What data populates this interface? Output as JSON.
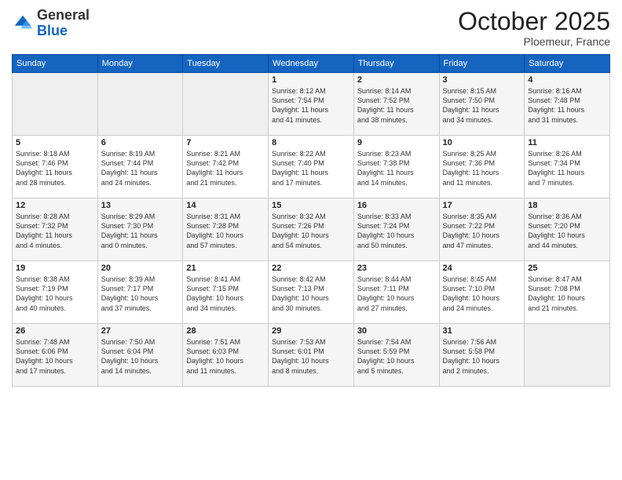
{
  "logo": {
    "general": "General",
    "blue": "Blue"
  },
  "header": {
    "month": "October 2025",
    "location": "Ploemeur, France"
  },
  "days_of_week": [
    "Sunday",
    "Monday",
    "Tuesday",
    "Wednesday",
    "Thursday",
    "Friday",
    "Saturday"
  ],
  "weeks": [
    [
      {
        "day": "",
        "info": ""
      },
      {
        "day": "",
        "info": ""
      },
      {
        "day": "",
        "info": ""
      },
      {
        "day": "1",
        "info": "Sunrise: 8:12 AM\nSunset: 7:54 PM\nDaylight: 11 hours\nand 41 minutes."
      },
      {
        "day": "2",
        "info": "Sunrise: 8:14 AM\nSunset: 7:52 PM\nDaylight: 11 hours\nand 38 minutes."
      },
      {
        "day": "3",
        "info": "Sunrise: 8:15 AM\nSunset: 7:50 PM\nDaylight: 11 hours\nand 34 minutes."
      },
      {
        "day": "4",
        "info": "Sunrise: 8:16 AM\nSunset: 7:48 PM\nDaylight: 11 hours\nand 31 minutes."
      }
    ],
    [
      {
        "day": "5",
        "info": "Sunrise: 8:18 AM\nSunset: 7:46 PM\nDaylight: 11 hours\nand 28 minutes."
      },
      {
        "day": "6",
        "info": "Sunrise: 8:19 AM\nSunset: 7:44 PM\nDaylight: 11 hours\nand 24 minutes."
      },
      {
        "day": "7",
        "info": "Sunrise: 8:21 AM\nSunset: 7:42 PM\nDaylight: 11 hours\nand 21 minutes."
      },
      {
        "day": "8",
        "info": "Sunrise: 8:22 AM\nSunset: 7:40 PM\nDaylight: 11 hours\nand 17 minutes."
      },
      {
        "day": "9",
        "info": "Sunrise: 8:23 AM\nSunset: 7:38 PM\nDaylight: 11 hours\nand 14 minutes."
      },
      {
        "day": "10",
        "info": "Sunrise: 8:25 AM\nSunset: 7:36 PM\nDaylight: 11 hours\nand 11 minutes."
      },
      {
        "day": "11",
        "info": "Sunrise: 8:26 AM\nSunset: 7:34 PM\nDaylight: 11 hours\nand 7 minutes."
      }
    ],
    [
      {
        "day": "12",
        "info": "Sunrise: 8:28 AM\nSunset: 7:32 PM\nDaylight: 11 hours\nand 4 minutes."
      },
      {
        "day": "13",
        "info": "Sunrise: 8:29 AM\nSunset: 7:30 PM\nDaylight: 11 hours\nand 0 minutes."
      },
      {
        "day": "14",
        "info": "Sunrise: 8:31 AM\nSunset: 7:28 PM\nDaylight: 10 hours\nand 57 minutes."
      },
      {
        "day": "15",
        "info": "Sunrise: 8:32 AM\nSunset: 7:26 PM\nDaylight: 10 hours\nand 54 minutes."
      },
      {
        "day": "16",
        "info": "Sunrise: 8:33 AM\nSunset: 7:24 PM\nDaylight: 10 hours\nand 50 minutes."
      },
      {
        "day": "17",
        "info": "Sunrise: 8:35 AM\nSunset: 7:22 PM\nDaylight: 10 hours\nand 47 minutes."
      },
      {
        "day": "18",
        "info": "Sunrise: 8:36 AM\nSunset: 7:20 PM\nDaylight: 10 hours\nand 44 minutes."
      }
    ],
    [
      {
        "day": "19",
        "info": "Sunrise: 8:38 AM\nSunset: 7:19 PM\nDaylight: 10 hours\nand 40 minutes."
      },
      {
        "day": "20",
        "info": "Sunrise: 8:39 AM\nSunset: 7:17 PM\nDaylight: 10 hours\nand 37 minutes."
      },
      {
        "day": "21",
        "info": "Sunrise: 8:41 AM\nSunset: 7:15 PM\nDaylight: 10 hours\nand 34 minutes."
      },
      {
        "day": "22",
        "info": "Sunrise: 8:42 AM\nSunset: 7:13 PM\nDaylight: 10 hours\nand 30 minutes."
      },
      {
        "day": "23",
        "info": "Sunrise: 8:44 AM\nSunset: 7:11 PM\nDaylight: 10 hours\nand 27 minutes."
      },
      {
        "day": "24",
        "info": "Sunrise: 8:45 AM\nSunset: 7:10 PM\nDaylight: 10 hours\nand 24 minutes."
      },
      {
        "day": "25",
        "info": "Sunrise: 8:47 AM\nSunset: 7:08 PM\nDaylight: 10 hours\nand 21 minutes."
      }
    ],
    [
      {
        "day": "26",
        "info": "Sunrise: 7:48 AM\nSunset: 6:06 PM\nDaylight: 10 hours\nand 17 minutes."
      },
      {
        "day": "27",
        "info": "Sunrise: 7:50 AM\nSunset: 6:04 PM\nDaylight: 10 hours\nand 14 minutes."
      },
      {
        "day": "28",
        "info": "Sunrise: 7:51 AM\nSunset: 6:03 PM\nDaylight: 10 hours\nand 11 minutes."
      },
      {
        "day": "29",
        "info": "Sunrise: 7:53 AM\nSunset: 6:01 PM\nDaylight: 10 hours\nand 8 minutes."
      },
      {
        "day": "30",
        "info": "Sunrise: 7:54 AM\nSunset: 5:59 PM\nDaylight: 10 hours\nand 5 minutes."
      },
      {
        "day": "31",
        "info": "Sunrise: 7:56 AM\nSunset: 5:58 PM\nDaylight: 10 hours\nand 2 minutes."
      },
      {
        "day": "",
        "info": ""
      }
    ]
  ]
}
